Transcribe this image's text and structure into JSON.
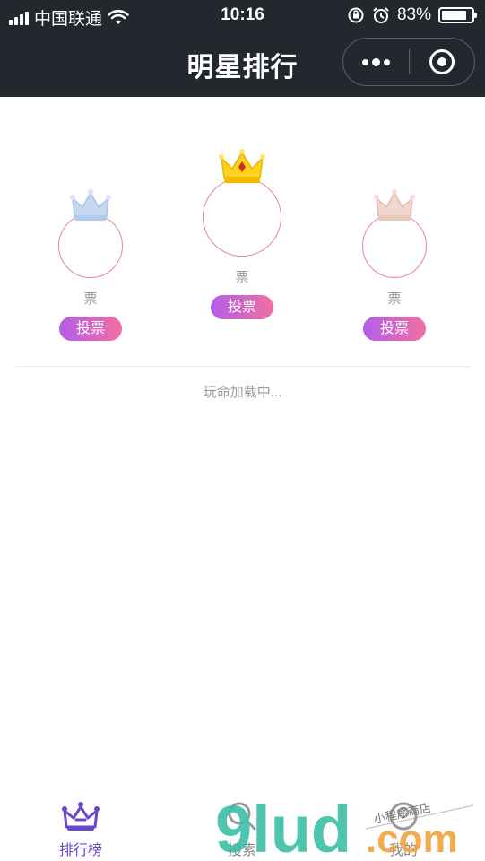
{
  "status": {
    "carrier": "中国联通",
    "time": "10:16",
    "battery": "83%",
    "battery_level": 0.83
  },
  "nav": {
    "title": "明星排行"
  },
  "podium": {
    "first": {
      "votes_label": "票",
      "vote_button": "投票",
      "crown": "gold-crown-icon"
    },
    "second": {
      "votes_label": "票",
      "vote_button": "投票",
      "crown": "silver-crown-icon"
    },
    "third": {
      "votes_label": "票",
      "vote_button": "投票",
      "crown": "bronze-crown-icon"
    }
  },
  "list": {
    "loading_text": "玩命加载中..."
  },
  "tabbar": {
    "items": [
      {
        "label": "排行榜",
        "icon": "crown-icon",
        "active": true
      },
      {
        "label": "搜索",
        "icon": "search-icon",
        "active": false
      },
      {
        "label": "我的",
        "icon": "user-icon",
        "active": false
      }
    ]
  },
  "watermark": {
    "main": "9lud",
    "tld": ".com",
    "tagline": "小程序商店"
  },
  "colors": {
    "nav_bg": "#23272e",
    "accent": "#6a47c9",
    "vote_gradient_start": "#b25ee8",
    "vote_gradient_end": "#f06fa3",
    "avatar_ring": "#e3889a"
  }
}
